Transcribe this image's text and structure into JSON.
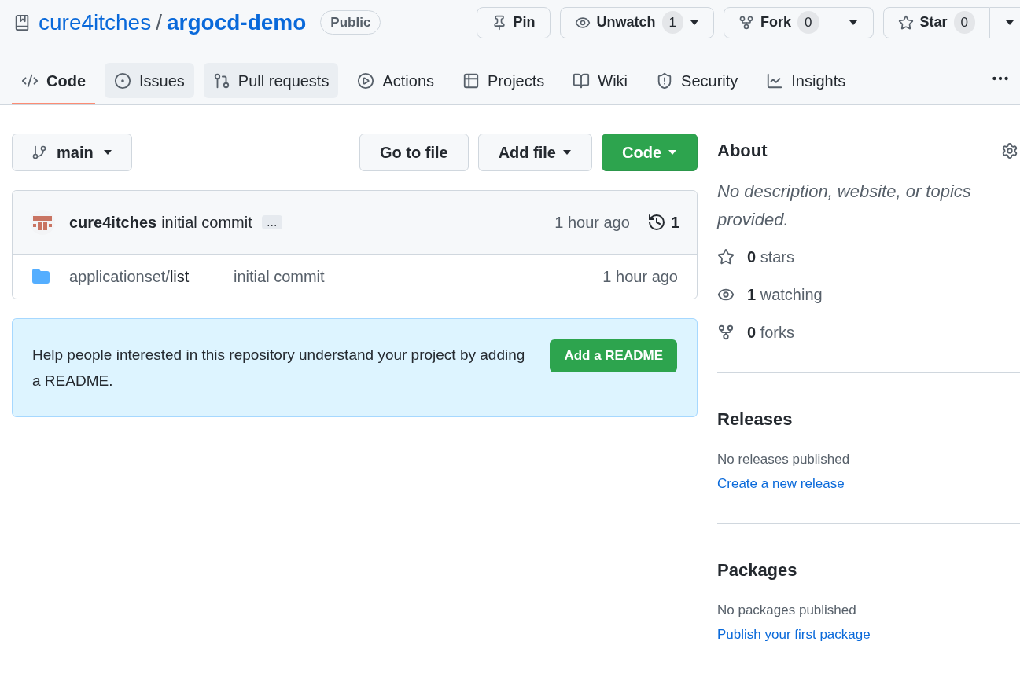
{
  "repo": {
    "owner": "cure4itches",
    "separator": "/",
    "name": "argocd-demo",
    "visibility": "Public"
  },
  "actions": [
    {
      "kind": "pin",
      "label": "Pin"
    },
    {
      "kind": "watch",
      "label": "Unwatch",
      "count": "1"
    },
    {
      "kind": "fork",
      "label": "Fork",
      "count": "0"
    },
    {
      "kind": "star",
      "label": "Star",
      "count": "0"
    }
  ],
  "tabs": [
    {
      "kind": "code",
      "label": "Code",
      "selected": true,
      "highlighted": false
    },
    {
      "kind": "issues",
      "label": "Issues",
      "selected": false,
      "highlighted": true
    },
    {
      "kind": "pulls",
      "label": "Pull requests",
      "selected": false,
      "highlighted": true
    },
    {
      "kind": "actions",
      "label": "Actions",
      "selected": false,
      "highlighted": false
    },
    {
      "kind": "projects",
      "label": "Projects",
      "selected": false,
      "highlighted": false
    },
    {
      "kind": "wiki",
      "label": "Wiki",
      "selected": false,
      "highlighted": false
    },
    {
      "kind": "security",
      "label": "Security",
      "selected": false,
      "highlighted": false
    },
    {
      "kind": "insights",
      "label": "Insights",
      "selected": false,
      "highlighted": false
    }
  ],
  "toolbar": {
    "branch": "main",
    "go_to_file": "Go to file",
    "add_file": "Add file",
    "code": "Code"
  },
  "commit": {
    "author": "cure4itches",
    "message": "initial commit",
    "ellipsis": "…",
    "time": "1 hour ago",
    "count": "1"
  },
  "files": [
    {
      "kind": "folder",
      "name_prefix": "applicationset/",
      "name": "list",
      "message": "initial commit",
      "time": "1 hour ago"
    }
  ],
  "readme_banner": {
    "text": "Help people interested in this repository understand your project by adding a README.",
    "button": "Add a README"
  },
  "about": {
    "title": "About",
    "description": "No description, website, or topics provided.",
    "stats": [
      {
        "kind": "stars",
        "count": "0",
        "label": "stars"
      },
      {
        "kind": "watching",
        "count": "1",
        "label": "watching"
      },
      {
        "kind": "forks",
        "count": "0",
        "label": "forks"
      }
    ]
  },
  "releases": {
    "title": "Releases",
    "empty": "No releases published",
    "link": "Create a new release"
  },
  "packages": {
    "title": "Packages",
    "empty": "No packages published",
    "link": "Publish your first package"
  }
}
